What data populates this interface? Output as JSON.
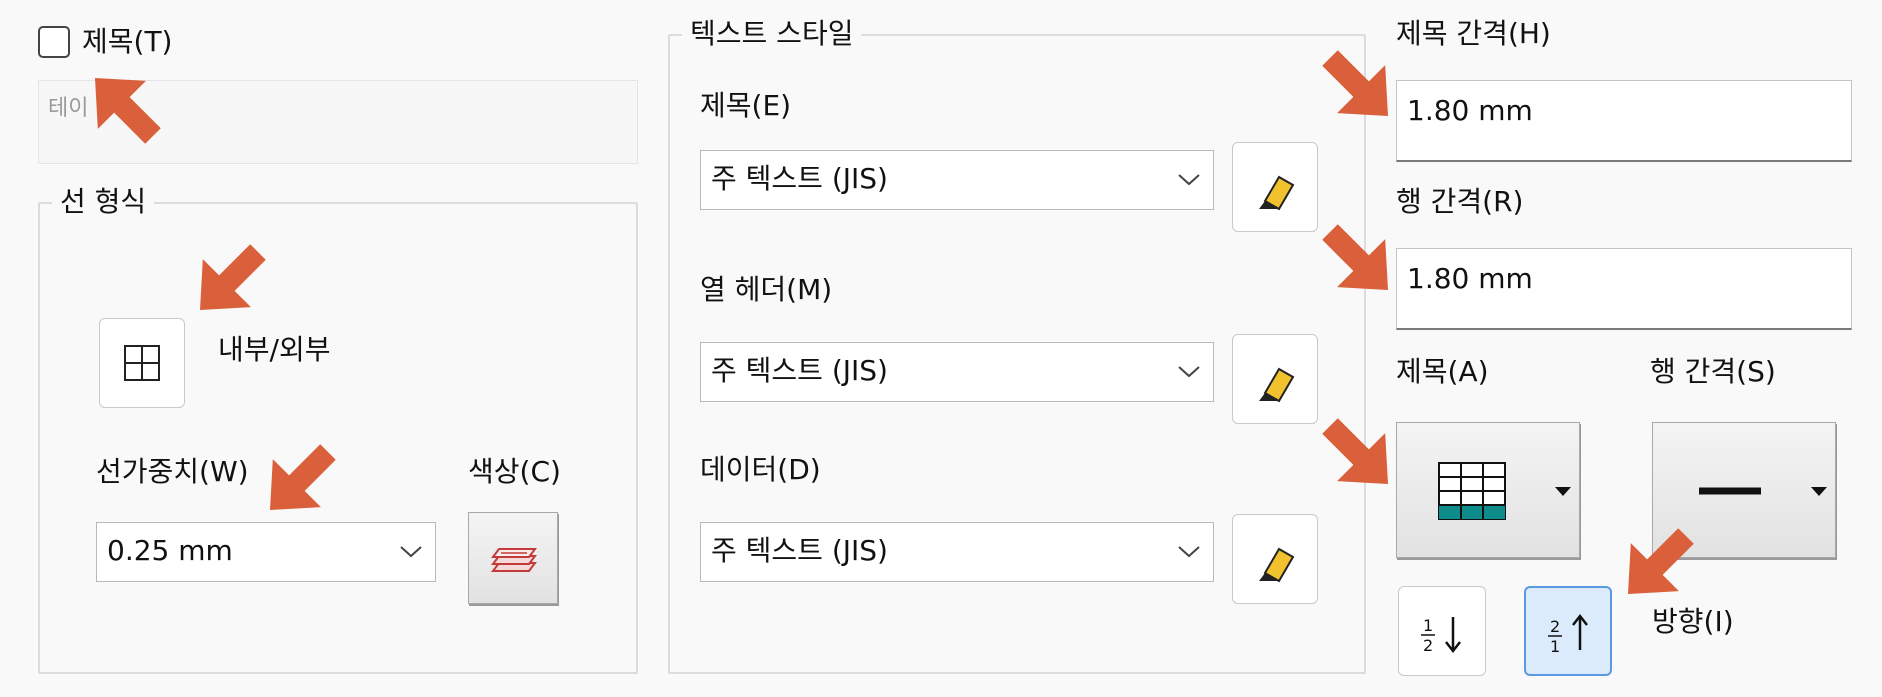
{
  "title_checkbox": {
    "label": "제목(T)"
  },
  "title_input": {
    "placeholder": "테이"
  },
  "line_format": {
    "legend": "선 형식",
    "inner_outer_label": "내부/외부",
    "weight_label": "선가중치(W)",
    "weight_value": "0.25 mm",
    "color_label": "색상(C)"
  },
  "text_style": {
    "legend": "텍스트 스타일",
    "title_label": "제목(E)",
    "title_value": "주 텍스트 (JIS)",
    "column_header_label": "열 헤더(M)",
    "column_header_value": "주 텍스트 (JIS)",
    "data_label": "데이터(D)",
    "data_value": "주 텍스트 (JIS)"
  },
  "spacing": {
    "title_gap_label": "제목 간격(H)",
    "title_gap_value": "1.80 mm",
    "row_gap_label": "행 간격(R)",
    "row_gap_value": "1.80 mm",
    "title_pos_label": "제목(A)",
    "row_spacing_label": "행 간격(S)",
    "direction_label": "방향(I)",
    "direction_down_glyph": "1/2 ↓",
    "direction_up_glyph": "2/1 ↑"
  },
  "colors": {
    "arrow": "#d9603b",
    "teal": "#0e8c8c",
    "pencil": "#f2c12e",
    "selected_bg": "#dcebfb",
    "selected_border": "#5a9ae0"
  }
}
